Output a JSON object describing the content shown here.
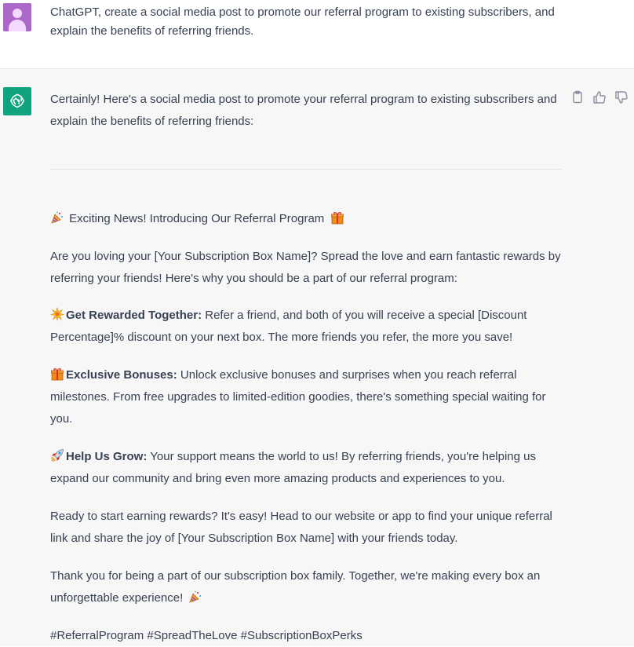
{
  "user_message": {
    "text": "ChatGPT, create a social media post to promote our referral program to existing subscribers, and explain the benefits of referring friends."
  },
  "assistant_message": {
    "intro": "Certainly! Here's a social media post to promote your referral program to existing subscribers and explain the benefits of referring friends:",
    "headline": "Exciting News! Introducing Our Referral Program",
    "paragraph1": "Are you loving your [Your Subscription Box Name]? Spread the love and earn fantastic rewards by referring your friends! Here's why you should be a part of our referral program:",
    "benefits": [
      {
        "title": "Get Rewarded Together:",
        "text": " Refer a friend, and both of you will receive a special [Discount Percentage]% discount on your next box. The more friends you refer, the more you save!",
        "icon": "sparkle-burst-icon"
      },
      {
        "title": "Exclusive Bonuses:",
        "text": " Unlock exclusive bonuses and surprises when you reach referral milestones. From free upgrades to limited-edition goodies, there's something special waiting for you.",
        "icon": "gift-icon"
      },
      {
        "title": "Help Us Grow:",
        "text": " Your support means the world to us! By referring friends, you're helping us expand our community and bring even more amazing products and experiences to you.",
        "icon": "rocket-icon"
      }
    ],
    "paragraph_ready": "Ready to start earning rewards? It's easy! Head to our website or app to find your unique referral link and share the joy of [Your Subscription Box Name] with your friends today.",
    "paragraph_thanks": "Thank you for being a part of our subscription box family. Together, we're making every box an unforgettable experience!",
    "hashtags": "#ReferralProgram #SpreadTheLove #SubscriptionBoxPerks"
  },
  "colors": {
    "user_avatar": "#ab68c9",
    "assistant_avatar": "#10a37f",
    "assistant_bg": "#f7f7f8",
    "text": "#374151"
  }
}
